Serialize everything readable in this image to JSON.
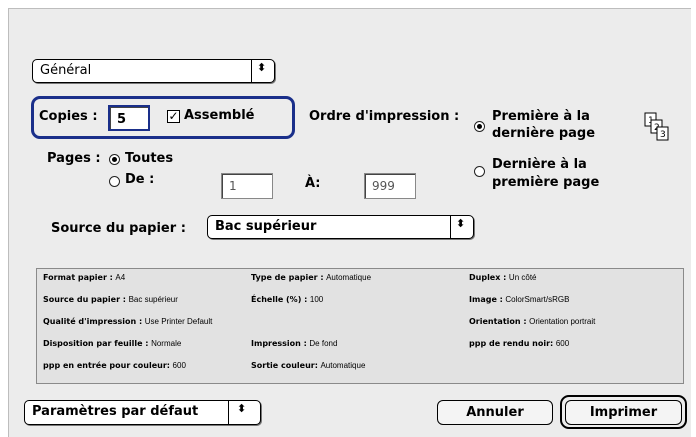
{
  "panel_popup": {
    "value": "Général"
  },
  "copies": {
    "label": "Copies :",
    "value": "5",
    "collate_label": "Assemblé",
    "collate_checked": true
  },
  "print_order": {
    "label": "Ordre d'impression :",
    "options": [
      "Première à la dernière page",
      "Dernière à la première page"
    ],
    "option1_line1": "Première à la",
    "option1_line2": "dernière page",
    "option2_line1": "Dernière à la",
    "option2_line2": "première page",
    "selected": 0
  },
  "pages": {
    "label": "Pages :",
    "all_label": "Toutes",
    "from_label": "De :",
    "from_value": "1",
    "to_label": "À:",
    "to_value": "999",
    "selected": "all"
  },
  "paper_source": {
    "label": "Source du papier :",
    "value": "Bac supérieur"
  },
  "summary": {
    "col1": [
      {
        "key": "Format papier :",
        "value": "A4"
      },
      {
        "key": "Source du papier :",
        "value": "Bac supérieur"
      },
      {
        "key": "Qualité d'impression :",
        "value": "Use Printer Default"
      },
      {
        "key": "Disposition par feuille :",
        "value": "Normale"
      },
      {
        "key": "ppp en entrée pour couleur:",
        "value": "600"
      }
    ],
    "col2": [
      {
        "key": "Type de papier :",
        "value": "Automatique"
      },
      {
        "key": "Échelle (%) :",
        "value": "100"
      },
      {
        "key": "",
        "value": ""
      },
      {
        "key": "Impression :",
        "value": "De fond"
      },
      {
        "key": "Sortie couleur:",
        "value": "Automatique"
      }
    ],
    "col3": [
      {
        "key": "Duplex :",
        "value": "Un côté"
      },
      {
        "key": "Image :",
        "value": "ColorSmart/sRGB"
      },
      {
        "key": "Orientation :",
        "value": "Orientation portrait"
      },
      {
        "key": "ppp de rendu noir:",
        "value": "600"
      }
    ]
  },
  "presets": {
    "value": "Paramètres par défaut"
  },
  "buttons": {
    "cancel": "Annuler",
    "print": "Imprimer"
  },
  "colors": {
    "highlight_border": "#1a2f8a",
    "background": "#ececec"
  }
}
